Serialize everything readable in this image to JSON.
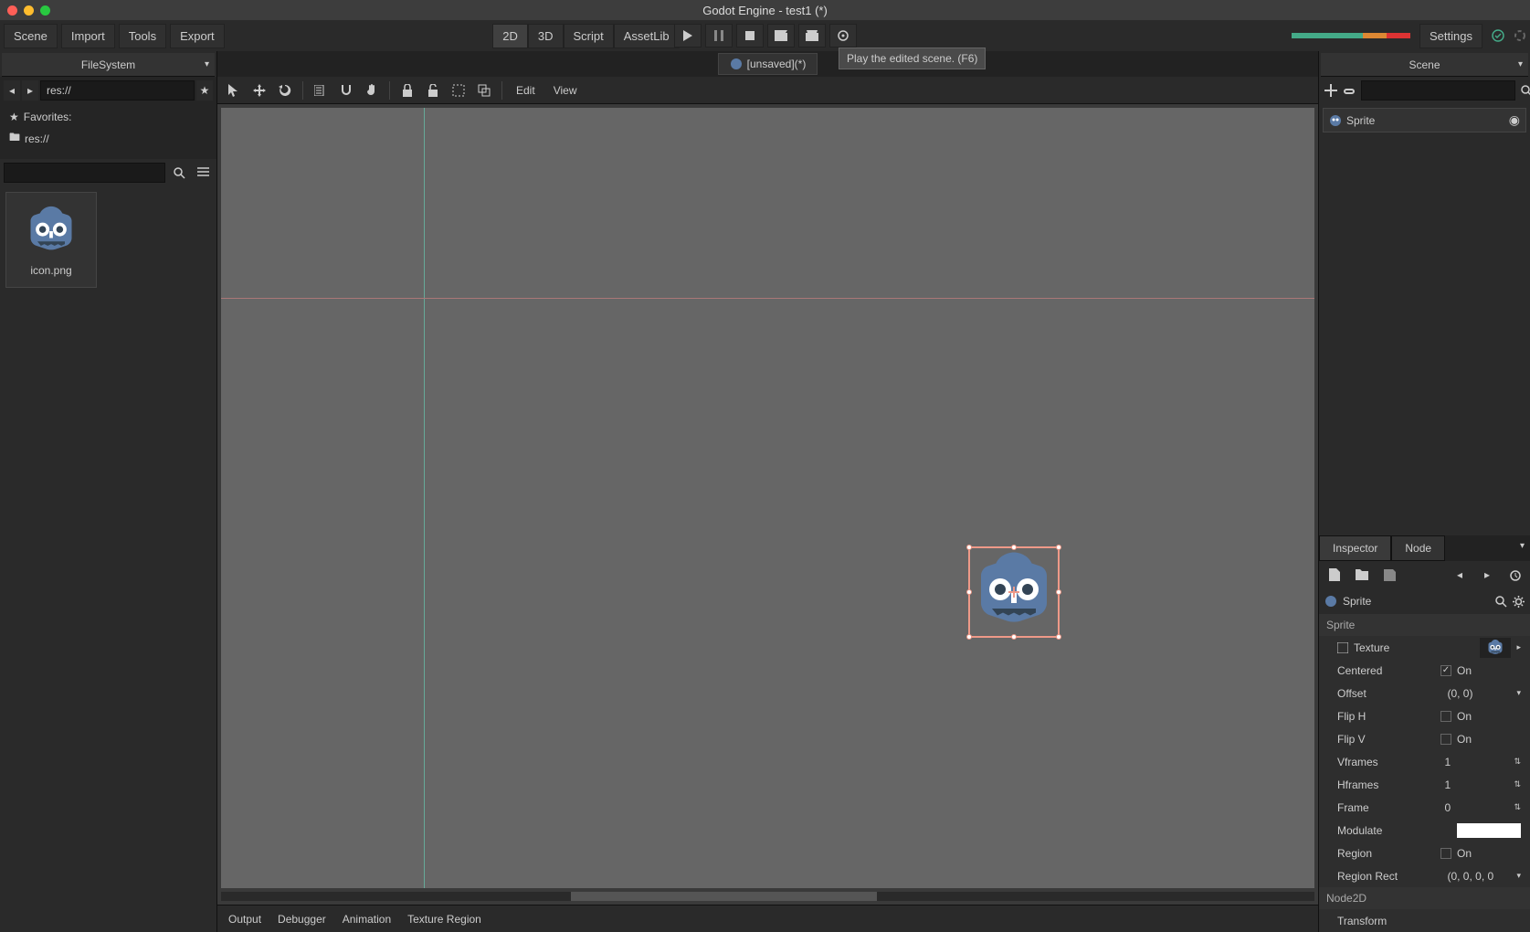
{
  "window": {
    "title": "Godot Engine - test1 (*)"
  },
  "menus": {
    "scene": "Scene",
    "import": "Import",
    "tools": "Tools",
    "export": "Export",
    "settings": "Settings"
  },
  "workspaces": {
    "2d": "2D",
    "3d": "3D",
    "script": "Script",
    "assetlib": "AssetLib"
  },
  "tooltip": "Play the edited scene. (F6)",
  "scene_tab": "[unsaved](*)",
  "viewport_menu": {
    "edit": "Edit",
    "view": "View"
  },
  "filesystem": {
    "tab": "FileSystem",
    "path": "res://",
    "favorites": "Favorites:",
    "res": "res://",
    "file": "icon.png"
  },
  "scene_panel": {
    "tab": "Scene",
    "root": "Sprite"
  },
  "inspector": {
    "tabs": {
      "inspector": "Inspector",
      "node": "Node"
    },
    "node_name": "Sprite",
    "cat_sprite": "Sprite",
    "cat_node2d": "Node2D",
    "props": {
      "texture": "Texture",
      "centered": "Centered",
      "centered_val": "On",
      "offset": "Offset",
      "offset_val": "(0, 0)",
      "fliph": "Flip H",
      "fliph_val": "On",
      "flipv": "Flip V",
      "flipv_val": "On",
      "vframes": "Vframes",
      "vframes_val": "1",
      "hframes": "Hframes",
      "hframes_val": "1",
      "frame": "Frame",
      "frame_val": "0",
      "modulate": "Modulate",
      "region": "Region",
      "region_val": "On",
      "regionrect": "Region Rect",
      "regionrect_val": "(0, 0, 0, 0",
      "transform": "Transform"
    }
  },
  "bottom": {
    "output": "Output",
    "debugger": "Debugger",
    "animation": "Animation",
    "texregion": "Texture Region"
  }
}
